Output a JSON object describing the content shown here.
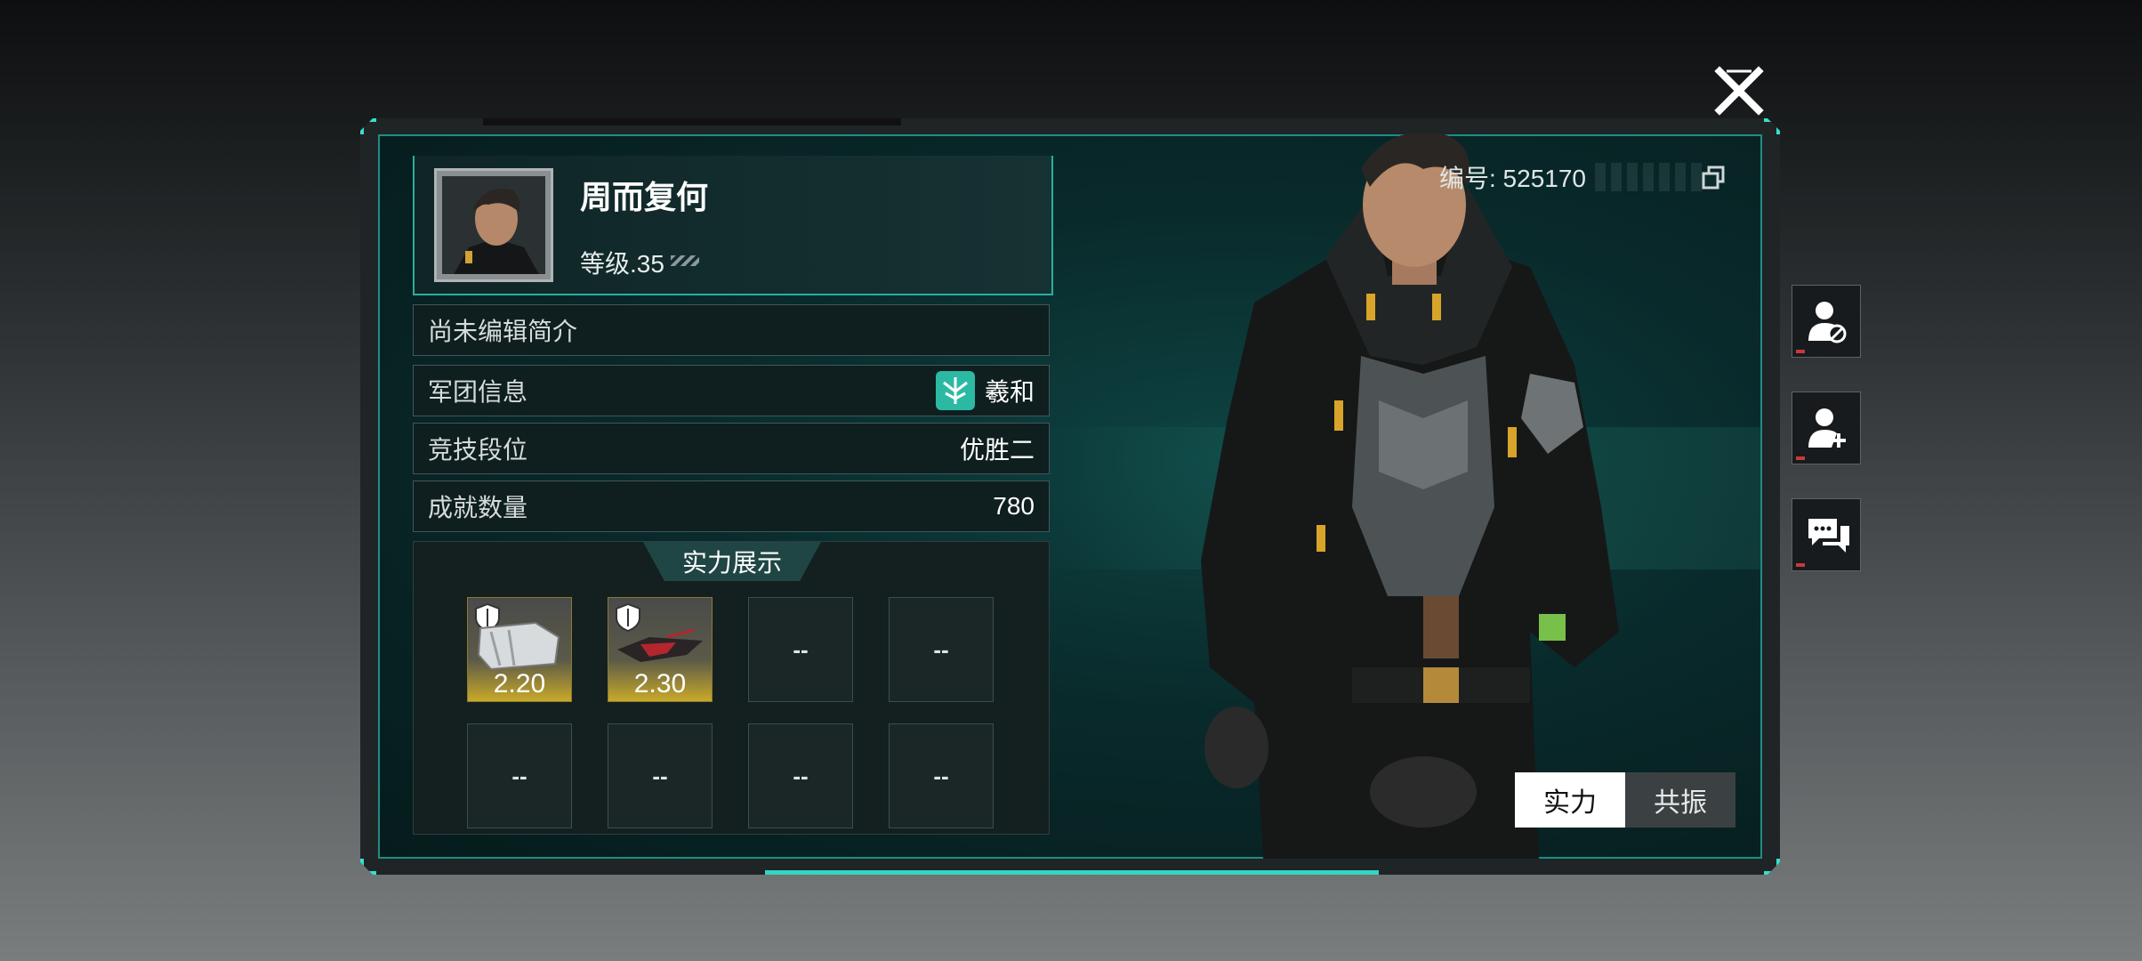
{
  "profile": {
    "name": "周而复何",
    "level_label": "等级.35",
    "id_label": "编号: 525170",
    "bio": "尚未编辑简介"
  },
  "info_rows": [
    {
      "label": "军团信息",
      "value": "羲和"
    },
    {
      "label": "竞技段位",
      "value": "优胜二"
    },
    {
      "label": "成就数量",
      "value": "780"
    }
  ],
  "showcase": {
    "title": "实力展示",
    "slots": [
      {
        "score": "2.20",
        "filled": true
      },
      {
        "score": "2.30",
        "filled": true
      },
      {
        "score": "--",
        "filled": false
      },
      {
        "score": "--",
        "filled": false
      },
      {
        "score": "--",
        "filled": false
      },
      {
        "score": "--",
        "filled": false
      },
      {
        "score": "--",
        "filled": false
      },
      {
        "score": "--",
        "filled": false
      }
    ]
  },
  "tabs": [
    "实力",
    "共振"
  ],
  "colors": {
    "accent": "#33d6c2",
    "panel_bg": "#092a2b",
    "slot_gold": "#c9a92a"
  },
  "icons": [
    "close-icon",
    "copy-icon",
    "block-user-icon",
    "add-friend-icon",
    "chat-icon",
    "legion-emblem-icon",
    "shield-icon"
  ]
}
